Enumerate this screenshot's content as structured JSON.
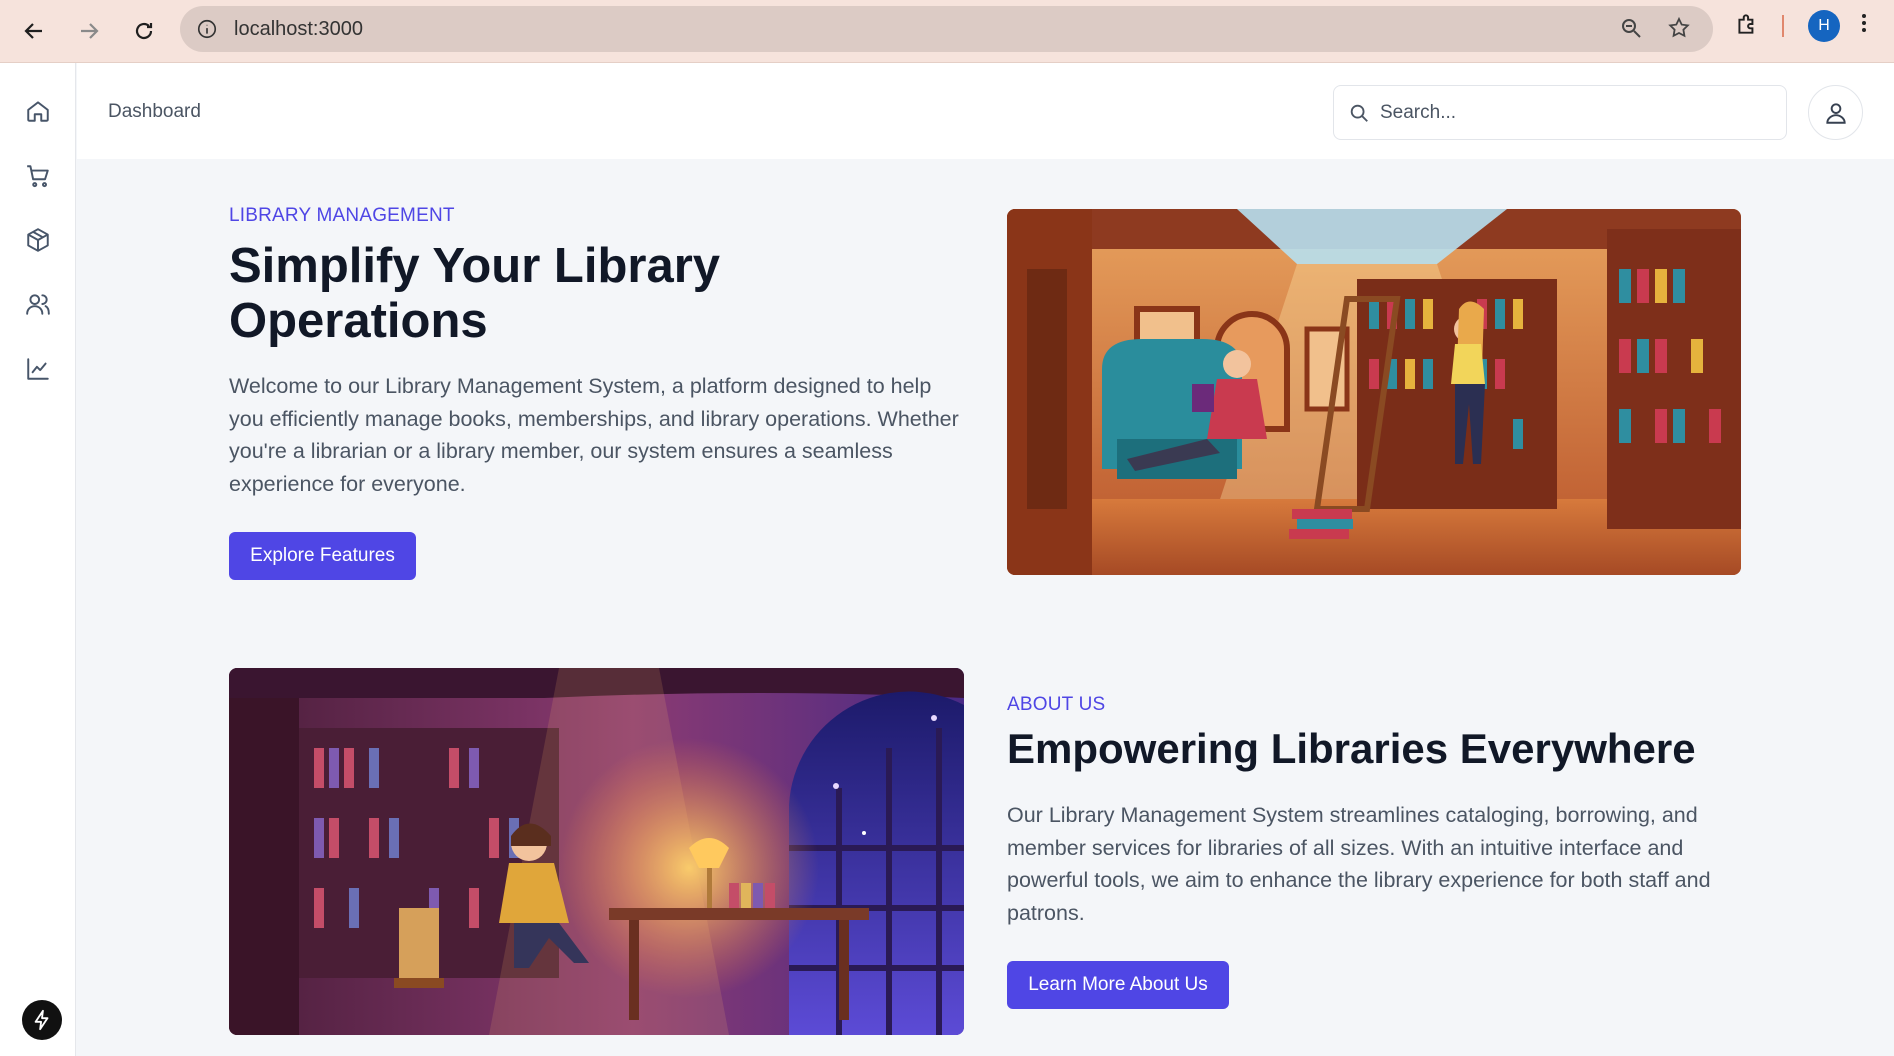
{
  "browser": {
    "url": "localhost:3000",
    "profile_initial": "H",
    "icons": [
      "back-arrow-icon",
      "forward-arrow-icon",
      "reload-icon",
      "site-info-icon",
      "zoom-icon",
      "bookmark-star-icon",
      "extensions-icon",
      "kebab-menu-icon"
    ]
  },
  "sidebar": {
    "items": [
      {
        "name": "home",
        "icon": "home-icon"
      },
      {
        "name": "cart",
        "icon": "cart-icon"
      },
      {
        "name": "products",
        "icon": "box-icon"
      },
      {
        "name": "users",
        "icon": "users-icon"
      },
      {
        "name": "analytics",
        "icon": "chart-icon"
      }
    ],
    "bottom_icon": "bolt-icon"
  },
  "header": {
    "breadcrumb": "Dashboard",
    "search_placeholder": "Search...",
    "user_icon": "user-icon"
  },
  "hero": {
    "eyebrow": "LIBRARY MANAGEMENT",
    "title_line1": "Simplify Your Library",
    "title_line2": "Operations",
    "paragraph_lines": [
      "Welcome to our Library Management System, a platform designed to help",
      "you efficiently manage books, memberships, and library operations. Whether",
      "you're a librarian or a library member, our system ensures a seamless",
      "experience for everyone."
    ],
    "button": "Explore Features"
  },
  "about": {
    "eyebrow": "ABOUT US",
    "title": "Empowering Libraries Everywhere",
    "paragraph_lines": [
      "Our Library Management System streamlines cataloging, borrowing, and",
      "member services for libraries of all sizes. With an intuitive interface and",
      "powerful tools, we aim to enhance the library experience for both staff and",
      "patrons."
    ],
    "button": "Learn More About Us"
  },
  "colors": {
    "accent": "#4f46e5",
    "chrome_bg": "#f6e3dc",
    "page_bg": "#f4f6f9"
  }
}
